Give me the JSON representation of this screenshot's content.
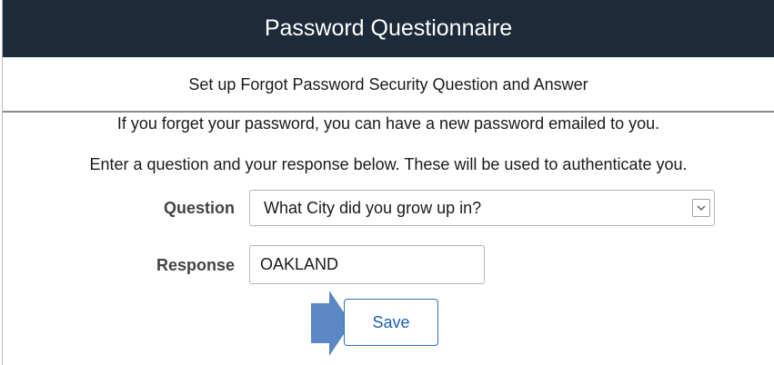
{
  "header": {
    "title": "Password Questionnaire"
  },
  "subheader": {
    "text": "Set up Forgot Password Security Question and Answer"
  },
  "instructions": {
    "line1": "If you forget your password, you can have a new password emailed to you.",
    "line2": "Enter a question and your response below. These will be used to authenticate you."
  },
  "form": {
    "question": {
      "label": "Question",
      "selected_value": "What City did you grow up in?"
    },
    "response": {
      "label": "Response",
      "value": "OAKLAND"
    },
    "save_label": "Save"
  },
  "icons": {
    "dropdown": "chevron-down-icon",
    "pointer": "arrow-right-icon"
  },
  "colors": {
    "header_bg": "#1c2a39",
    "header_text": "#ffffff",
    "button_border": "#2f6fbf",
    "button_text": "#1a5fb4",
    "pointer_arrow": "#5b87c4"
  }
}
